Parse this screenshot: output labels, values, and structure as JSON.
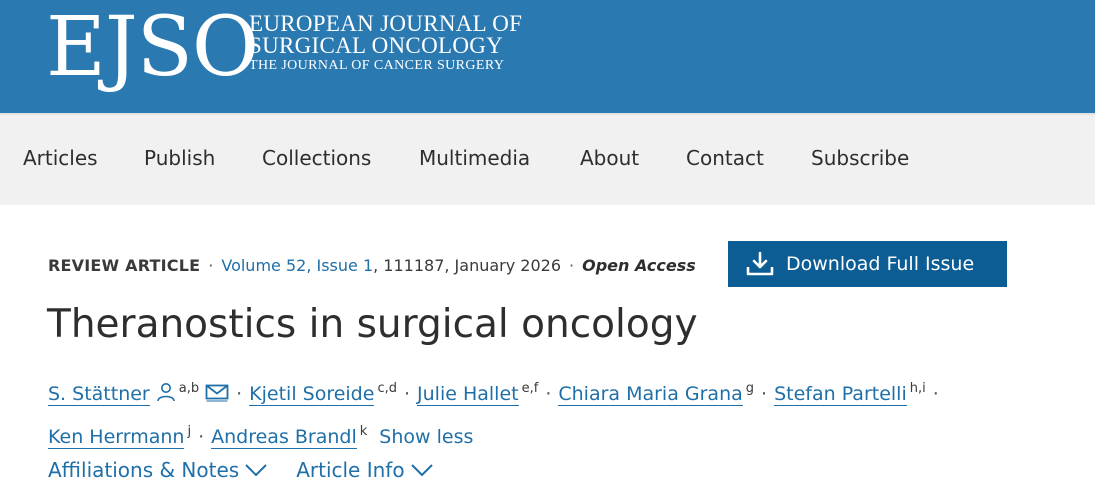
{
  "brand": {
    "mark": "EJSO",
    "line1": "EUROPEAN JOURNAL OF",
    "line2": "SURGICAL ONCOLOGY",
    "line3": "THE JOURNAL OF CANCER SURGERY",
    "banner_color": "#2a79b1"
  },
  "nav": {
    "articles": "Articles",
    "publish": "Publish",
    "collections": "Collections",
    "multimedia": "Multimedia",
    "about": "About",
    "contact": "Contact",
    "subscribe": "Subscribe"
  },
  "article": {
    "type": "REVIEW ARTICLE",
    "volume_issue": "Volume 52, Issue 1",
    "number_date": ", 111187, January 2026",
    "access": "Open Access",
    "title": "Theranostics in surgical oncology",
    "download_label": "Download Full Issue",
    "show_less": "Show less",
    "affiliations_label": "Affiliations & Notes",
    "article_info_label": "Article Info",
    "link_color": "#1f6fa8",
    "button_color": "#0b5d93"
  },
  "authors": [
    {
      "name": "S. Stättner",
      "sup": "a,b"
    },
    {
      "name": "Kjetil Soreide",
      "sup": "c,d"
    },
    {
      "name": "Julie Hallet",
      "sup": "e,f"
    },
    {
      "name": "Chiara Maria Grana",
      "sup": "g"
    },
    {
      "name": "Stefan Partelli",
      "sup": "h,i"
    },
    {
      "name": "Ken Herrmann",
      "sup": "j"
    },
    {
      "name": "Andreas Brandl",
      "sup": "k"
    }
  ]
}
